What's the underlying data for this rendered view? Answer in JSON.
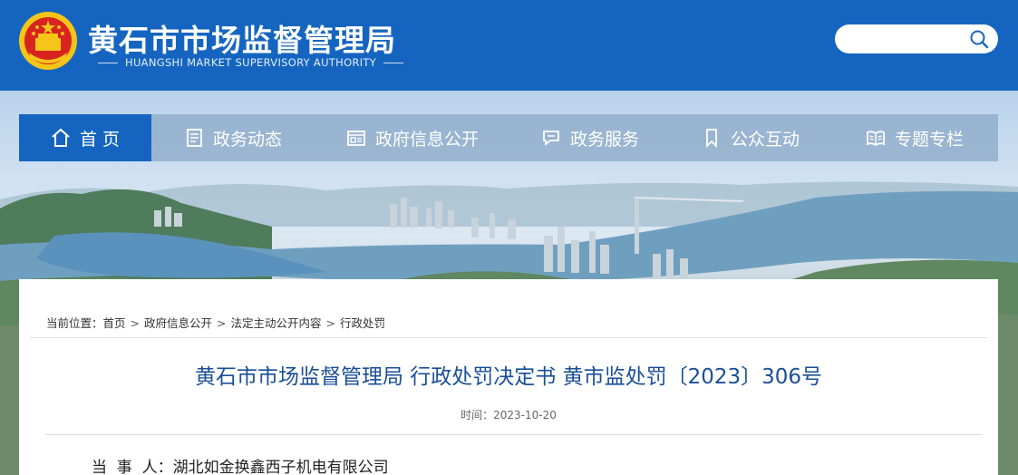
{
  "header": {
    "site_title": "黄石市市场监督管理局",
    "site_subtitle": "HUANGSHI MARKET SUPERVISORY AUTHORITY",
    "search": {
      "value": "",
      "icon": "search-icon"
    }
  },
  "nav": {
    "items": [
      {
        "label": "首 页",
        "icon": "home-icon"
      },
      {
        "label": "政务动态",
        "icon": "news-icon"
      },
      {
        "label": "政府信息公开",
        "icon": "info-disclosure-icon"
      },
      {
        "label": "政务服务",
        "icon": "service-chat-icon"
      },
      {
        "label": "公众互动",
        "icon": "bookmark-icon"
      },
      {
        "label": "专题专栏",
        "icon": "book-icon"
      }
    ]
  },
  "breadcrumb": {
    "prefix": "当前位置：",
    "items": [
      "首页",
      "政府信息公开",
      "法定主动公开内容",
      "行政处罚"
    ],
    "separator": ">"
  },
  "article": {
    "title": "黄石市市场监督管理局 行政处罚决定书 黄市监处罚〔2023〕306号",
    "publish_time": "时间：2023-10-20",
    "party_line": "当  事  人：湖北如金换鑫西子机电有限公司"
  },
  "colors": {
    "header_bg": "#1565c0",
    "nav_active_bg": "#1565c0",
    "title_color": "#1a4f98"
  }
}
